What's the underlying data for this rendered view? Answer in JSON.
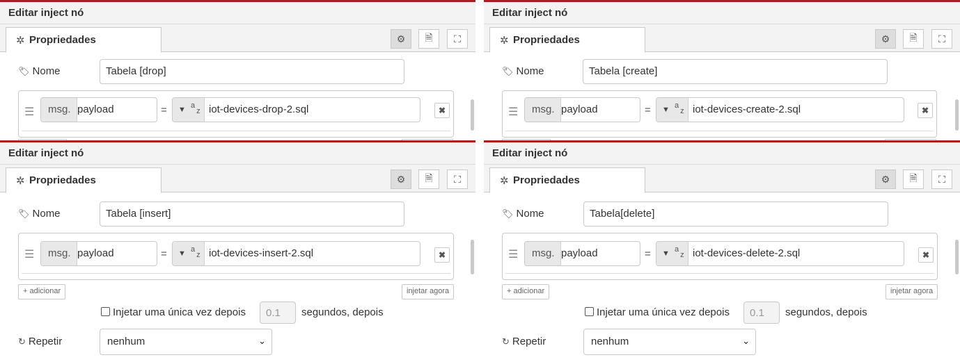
{
  "colors": {
    "accent_border": "#a32121",
    "header_bg": "#f3f3f3",
    "border": "#c9c9c9"
  },
  "common": {
    "tray_title": "Editar inject nó",
    "tab_label": "Propriedades",
    "tab_icon": "cog-icon",
    "name_label": "Nome",
    "msg_prefix": "msg.",
    "property": "payload",
    "equals": "=",
    "add_label": "adicionar",
    "inject_now_label": "injetar agora",
    "once_label": "Injetar uma única vez depois",
    "once_delay_placeholder": "0.1",
    "seconds_label": "segundos, depois",
    "repeat_label": "Repetir",
    "repeat_value": "nenhum"
  },
  "panels": [
    {
      "name_value": "Tabela [drop]",
      "payload_value": "iot-devices-drop-2.sql"
    },
    {
      "name_value": "Tabela [create]",
      "payload_value": "iot-devices-create-2.sql"
    },
    {
      "name_value": "Tabela [insert]",
      "payload_value": "iot-devices-insert-2.sql"
    },
    {
      "name_value": "Tabela[delete]",
      "payload_value": "iot-devices-delete-2.sql"
    }
  ]
}
